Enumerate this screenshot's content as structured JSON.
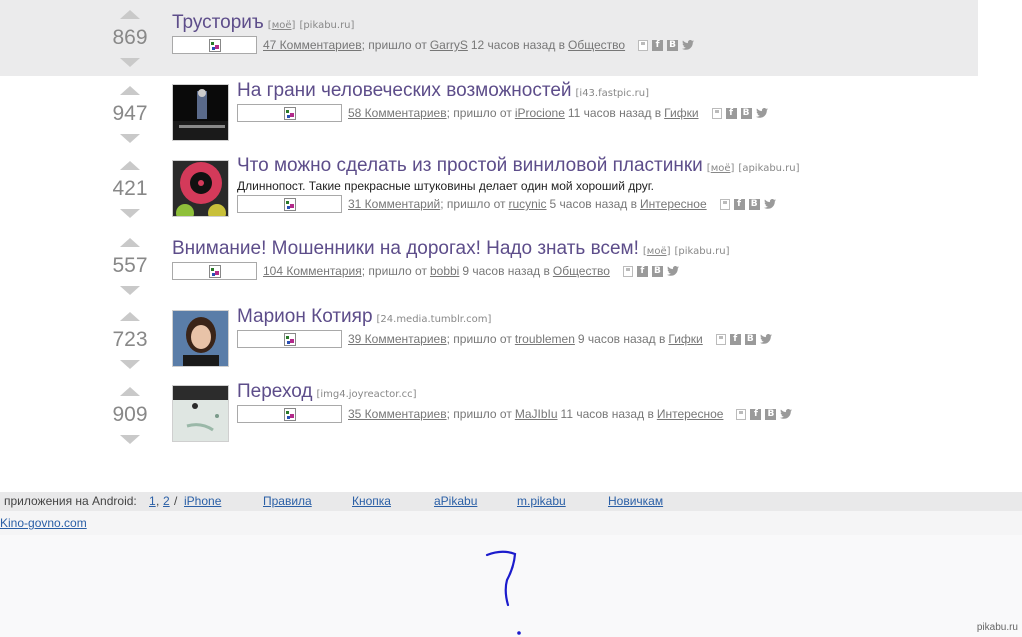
{
  "icons": {
    "broken_image": "broken-image-icon",
    "save": "save-icon",
    "facebook": "facebook-icon",
    "vk": "vk-icon",
    "twitter": "twitter-icon"
  },
  "icon_glyphs": {
    "facebook": "f",
    "vk": "B"
  },
  "colors": {
    "title": "#5d4d8a",
    "link": "#2a5fa6",
    "highlight": "#ebebec",
    "handwriting": "#1c1ccc"
  },
  "stories": [
    {
      "score": "869",
      "title": "Трусториъ",
      "mine": "моё",
      "source": "[pikabu.ru]",
      "comments": "47 Комментариев",
      "came_from": "; пришло от",
      "author": "GarryS",
      "time_ago": "12 часов назад в",
      "category": "Общество"
    },
    {
      "score": "947",
      "title": "На грани человеческих возможностей",
      "source": "[i43.fastpic.ru]",
      "comments": "58 Комментариев",
      "came_from": "; пришло от",
      "author": "iProcione",
      "time_ago": "11 часов назад в",
      "category": "Гифки"
    },
    {
      "score": "421",
      "title": "Что можно сделать из простой виниловой пластинки",
      "mine": "моё",
      "source": "[apikabu.ru]",
      "description": "Длиннопост. Такие прекрасные штуковины делает один мой хороший друг.",
      "comments": "31 Комментарий",
      "came_from": "; пришло от",
      "author": "rucynic",
      "time_ago": "5 часов назад в",
      "category": "Интересное"
    },
    {
      "score": "557",
      "title": "Внимание! Мошенники на дорогах! Надо знать всем!",
      "mine": "моё",
      "source": "[pikabu.ru]",
      "comments": "104 Комментария",
      "came_from": "; пришло от",
      "author": "bobbi",
      "time_ago": "9 часов назад в",
      "category": "Общество"
    },
    {
      "score": "723",
      "title": "Марион Котияр",
      "source": "[24.media.tumblr.com]",
      "comments": "39 Комментариев",
      "came_from": "; пришло от",
      "author": "troublemen",
      "time_ago": "9 часов назад в",
      "category": "Гифки"
    },
    {
      "score": "909",
      "title": "Переход",
      "source": "[img4.joyreactor.cc]",
      "comments": "35 Комментариев",
      "came_from": "; пришло от",
      "author": "MaJIbIu",
      "time_ago": "11 часов назад в",
      "category": "Интересное"
    }
  ],
  "footer": {
    "apps_label": "приложения на Android:",
    "android_1": "1",
    "comma": ",",
    "android_2": "2",
    "slash": "/",
    "iphone": "iPhone",
    "rules": "Правила",
    "button": "Кнопка",
    "apikabu": "aPikabu",
    "mobile": "m.pikabu",
    "newcomers": "Новичкам",
    "kino": "Kino-govno.com"
  },
  "watermark": "pikabu.ru"
}
